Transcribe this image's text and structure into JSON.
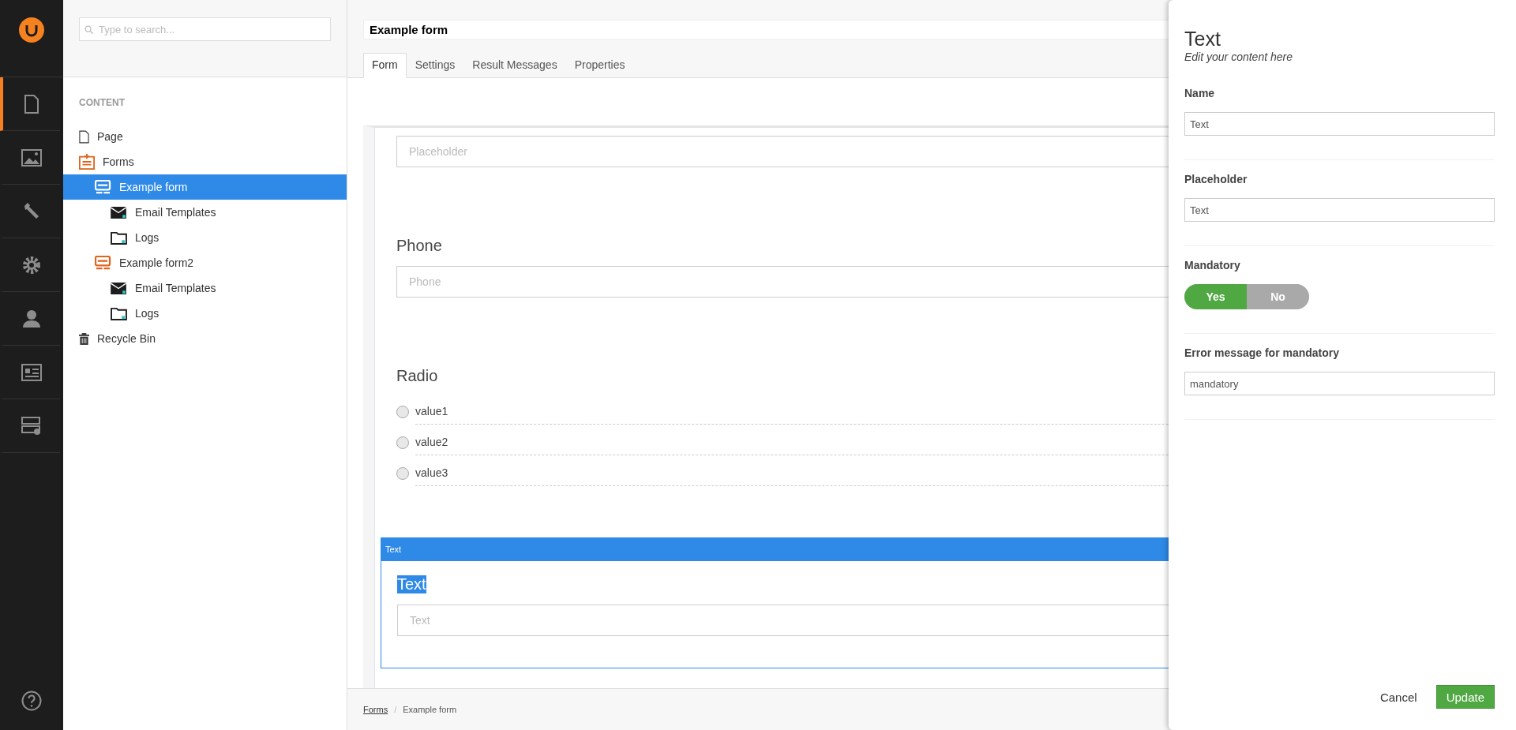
{
  "nav": {
    "items": [
      {
        "kind": "content",
        "selected": true
      },
      {
        "kind": "media",
        "selected": false
      },
      {
        "kind": "settings",
        "selected": false
      },
      {
        "kind": "developer",
        "selected": false
      },
      {
        "kind": "users",
        "selected": false
      },
      {
        "kind": "members",
        "selected": false
      },
      {
        "kind": "forms",
        "selected": false
      }
    ]
  },
  "tree": {
    "search": {
      "placeholder": "Type to search..."
    },
    "section": "CONTENT",
    "items": [
      {
        "label": "Page",
        "kind": "page",
        "selected": false
      },
      {
        "label": "Forms",
        "kind": "forms",
        "selected": false,
        "children": [
          {
            "label": "Example form",
            "kind": "form",
            "selected": true,
            "children": [
              {
                "label": "Email Templates",
                "kind": "mail",
                "selected": false
              },
              {
                "label": "Logs",
                "kind": "folder",
                "selected": false
              }
            ]
          },
          {
            "label": "Example form2",
            "kind": "form",
            "selected": false,
            "children": [
              {
                "label": "Email Templates",
                "kind": "mail",
                "selected": false
              },
              {
                "label": "Logs",
                "kind": "folder",
                "selected": false
              }
            ]
          }
        ]
      },
      {
        "label": "Recycle Bin",
        "kind": "bin",
        "selected": false
      }
    ]
  },
  "editor": {
    "name": "Example form",
    "tabs": [
      {
        "label": "Form",
        "selected": true
      },
      {
        "label": "Settings",
        "selected": false
      },
      {
        "label": "Result Messages",
        "selected": false
      },
      {
        "label": "Properties",
        "selected": false
      }
    ],
    "fields": [
      {
        "kind": "text",
        "placeholder": "Placeholder",
        "selected": false
      },
      {
        "kind": "text",
        "label": "Phone",
        "placeholder": "Phone",
        "selected": false
      },
      {
        "kind": "radio",
        "label": "Radio",
        "options": [
          {
            "label": "value1",
            "selected": false
          },
          {
            "label": "value2",
            "selected": false
          },
          {
            "label": "value3",
            "selected": false
          }
        ],
        "selected": false
      },
      {
        "kind": "text",
        "caption": "Text",
        "label": "Text",
        "placeholder": "Text",
        "selected": true
      }
    ]
  },
  "breadcrumb": {
    "separator": "/",
    "items": [
      {
        "label": "Forms",
        "link": true
      },
      {
        "label": "Example form",
        "link": false
      }
    ]
  },
  "dialog": {
    "title": "Text",
    "subtitle": "Edit your content here",
    "settings": [
      {
        "kind": "input",
        "label": "Name",
        "value": "Text"
      },
      {
        "kind": "input",
        "label": "Placeholder",
        "value": "Text"
      },
      {
        "kind": "toggle",
        "label": "Mandatory",
        "options": [
          {
            "label": "Yes",
            "selected": true
          },
          {
            "label": "No",
            "selected": false
          }
        ]
      },
      {
        "kind": "input",
        "label": "Error message for mandatory",
        "value": "mandatory"
      }
    ],
    "buttons": [
      {
        "label": "Cancel",
        "kind": "link"
      },
      {
        "label": "Update",
        "kind": "primary"
      }
    ]
  }
}
